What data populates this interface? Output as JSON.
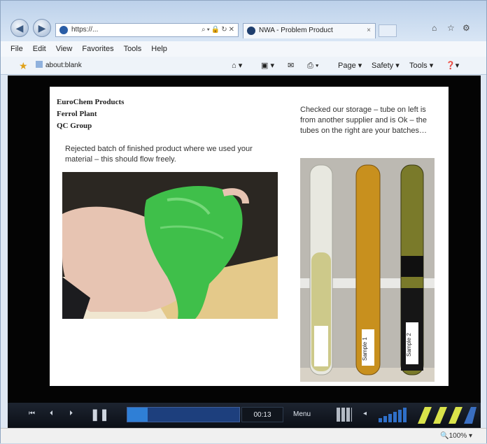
{
  "browser": {
    "address": "https://...",
    "tab_title": "NWA - Problem Product",
    "menu": [
      "File",
      "Edit",
      "View",
      "Favorites",
      "Tools",
      "Help"
    ],
    "favorites_link": "about:blank",
    "commands": [
      "Page ▾",
      "Safety ▾",
      "Tools ▾"
    ],
    "zoom": "100%"
  },
  "slide": {
    "header_lines": [
      "EuroChem Products",
      "Ferrol Plant",
      "QC Group"
    ],
    "caption_left": "Rejected batch of finished product where we used your material – this should flow freely.",
    "caption_right": "Checked our storage – tube on left is from another supplier and is Ok – the tubes on the right are your batches…",
    "tube_labels": [
      "Sample 1",
      "Sample 2"
    ]
  },
  "player": {
    "time": "00:13",
    "menu_label": "Menu",
    "progress_fraction": 0.18
  },
  "colors": {
    "slime": "#3fbf4a",
    "player_progress": "#2f7fd6",
    "brand_logo": "#d9e24a"
  }
}
